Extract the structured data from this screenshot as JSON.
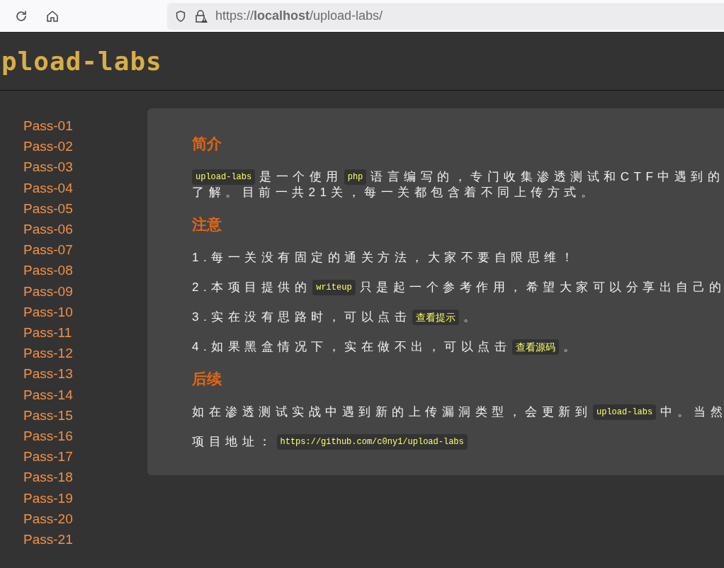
{
  "browser": {
    "url": "https://**localhost**/upload-labs/"
  },
  "header": {
    "logo": "pload-labs"
  },
  "sidebar": {
    "items": [
      {
        "label": "Pass-01"
      },
      {
        "label": "Pass-02"
      },
      {
        "label": "Pass-03"
      },
      {
        "label": "Pass-04"
      },
      {
        "label": "Pass-05"
      },
      {
        "label": "Pass-06"
      },
      {
        "label": "Pass-07"
      },
      {
        "label": "Pass-08"
      },
      {
        "label": "Pass-09"
      },
      {
        "label": "Pass-10"
      },
      {
        "label": "Pass-11"
      },
      {
        "label": "Pass-12"
      },
      {
        "label": "Pass-13"
      },
      {
        "label": "Pass-14"
      },
      {
        "label": "Pass-15"
      },
      {
        "label": "Pass-16"
      },
      {
        "label": "Pass-17"
      },
      {
        "label": "Pass-18"
      },
      {
        "label": "Pass-19"
      },
      {
        "label": "Pass-20"
      },
      {
        "label": "Pass-21"
      }
    ]
  },
  "sections": [
    {
      "heading": "简介",
      "paragraphs": [
        {
          "lines": [
            [
              {
                "kind": "code",
                "text": "upload-labs"
              },
              {
                "kind": "text",
                "text": "是一个使用"
              },
              {
                "kind": "code",
                "text": "php"
              },
              {
                "kind": "text",
                "text": "语言编写的，专门收集渗透测试和CTF中遇到的"
              }
            ],
            [
              {
                "kind": "text",
                "text": "了解。目前一共21关，每一关都包含着不同上传方式。"
              }
            ]
          ]
        }
      ]
    },
    {
      "heading": "注意",
      "paragraphs": [
        {
          "lines": [
            [
              {
                "kind": "text",
                "text": "1.每一关没有固定的通关方法，大家不要自限思维！"
              }
            ]
          ]
        },
        {
          "lines": [
            [
              {
                "kind": "text",
                "text": "2.本项目提供的"
              },
              {
                "kind": "code",
                "text": "writeup"
              },
              {
                "kind": "text",
                "text": "只是起一个参考作用，希望大家可以分享出自己的"
              }
            ]
          ]
        },
        {
          "lines": [
            [
              {
                "kind": "text",
                "text": "3.实在没有思路时，可以点击"
              },
              {
                "kind": "button",
                "text": "查看提示"
              },
              {
                "kind": "text",
                "text": "。"
              }
            ]
          ]
        },
        {
          "lines": [
            [
              {
                "kind": "text",
                "text": "4.如果黑盒情况下，实在做不出，可以点击"
              },
              {
                "kind": "button",
                "text": "查看源码"
              },
              {
                "kind": "text",
                "text": "。"
              }
            ]
          ]
        }
      ]
    },
    {
      "heading": "后续",
      "paragraphs": [
        {
          "lines": [
            [
              {
                "kind": "text",
                "text": "如在渗透测试实战中遇到新的上传漏洞类型，会更新到"
              },
              {
                "kind": "code",
                "text": "upload-labs"
              },
              {
                "kind": "text",
                "text": "中。当然"
              }
            ]
          ]
        },
        {
          "lines": [
            [
              {
                "kind": "text",
                "text": "项目地址："
              },
              {
                "kind": "link",
                "text": "https://github.com/c0ny1/upload-labs"
              }
            ]
          ]
        }
      ]
    }
  ]
}
